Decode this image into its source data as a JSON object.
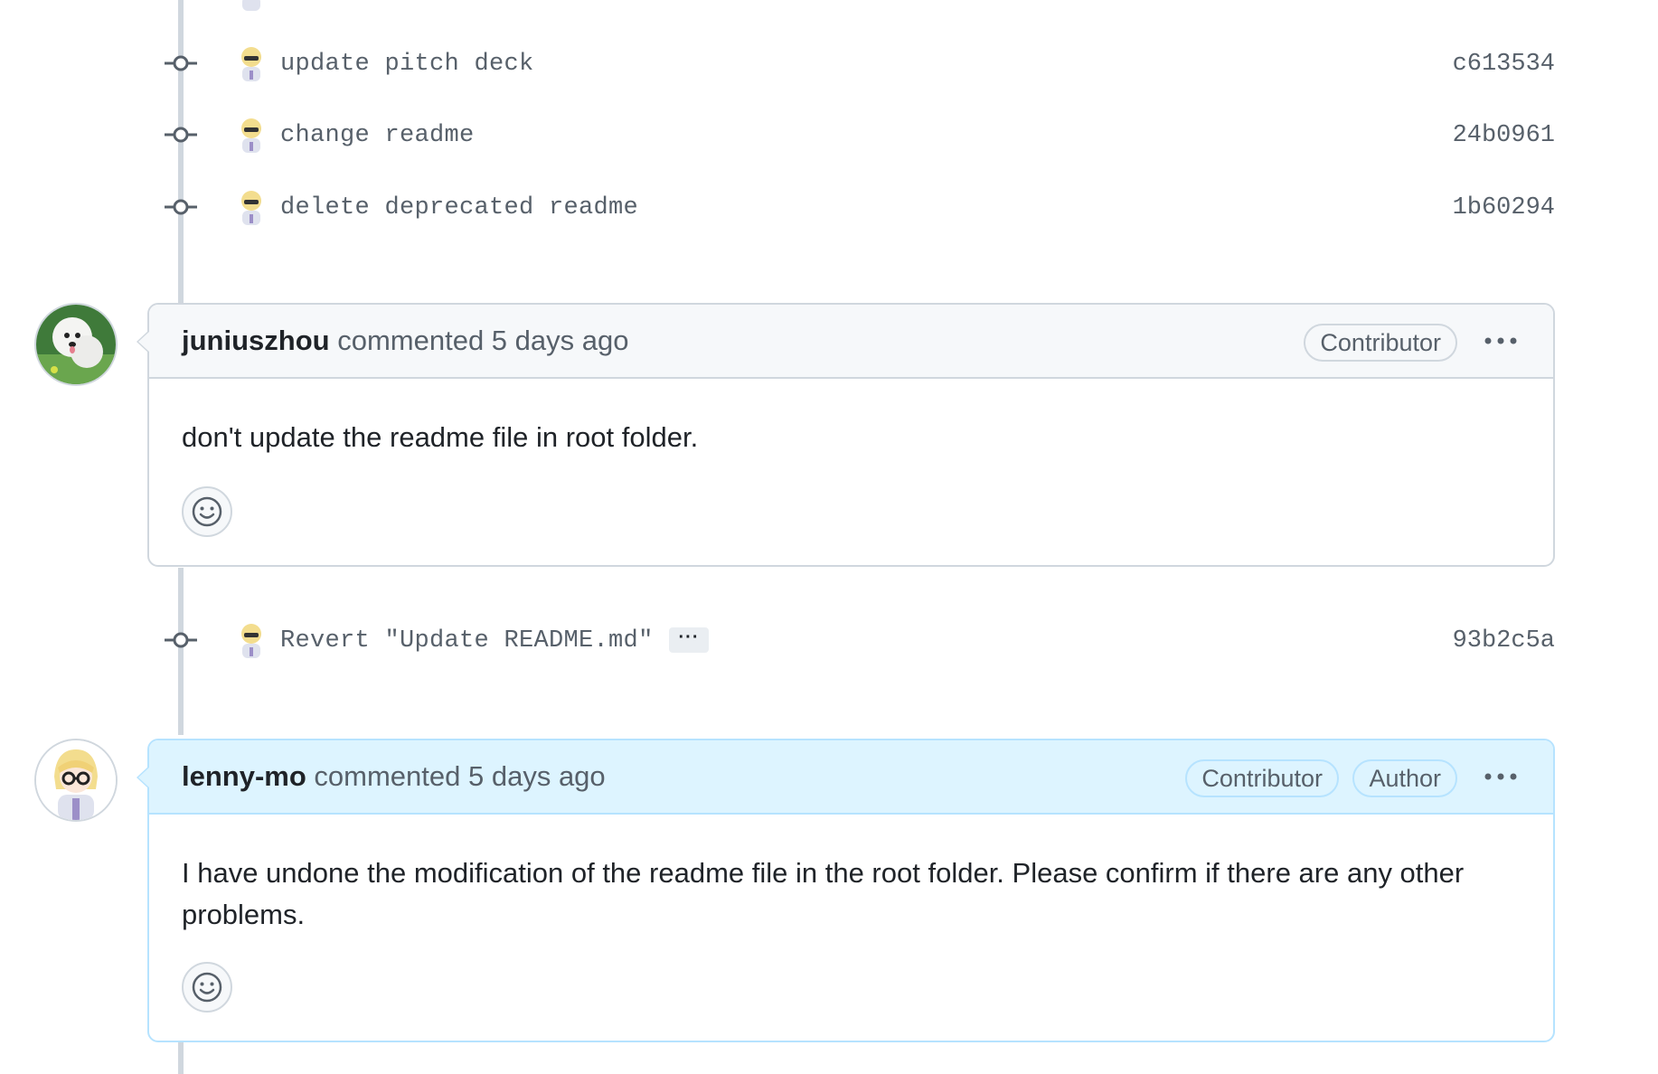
{
  "commits_top": [
    {
      "message": "update pitch deck",
      "sha": "c613534"
    },
    {
      "message": "change readme",
      "sha": "24b0961"
    },
    {
      "message": "delete deprecated readme",
      "sha": "1b60294"
    }
  ],
  "comment1": {
    "username": "juniuszhou",
    "meta": "commented 5 days ago",
    "badges": [
      "Contributor"
    ],
    "body": "don't update the readme file in root folder."
  },
  "commit_middle": {
    "message": "Revert \"Update README.md\"",
    "ellipsis": "···",
    "sha": "93b2c5a"
  },
  "comment2": {
    "username": "lenny-mo",
    "meta": "commented 5 days ago",
    "badges": [
      "Contributor",
      "Author"
    ],
    "body": "I have undone the modification of the readme file in the root folder. Please confirm if there are any other problems."
  },
  "icons": {
    "commit": "git-commit-icon",
    "reaction": "smiley-icon",
    "menu": "kebab-horizontal-icon"
  },
  "colors": {
    "author_header_bg": "#ddf4ff",
    "default_header_bg": "#f6f8fa",
    "border": "#d0d7de",
    "muted_text": "#57606a"
  }
}
